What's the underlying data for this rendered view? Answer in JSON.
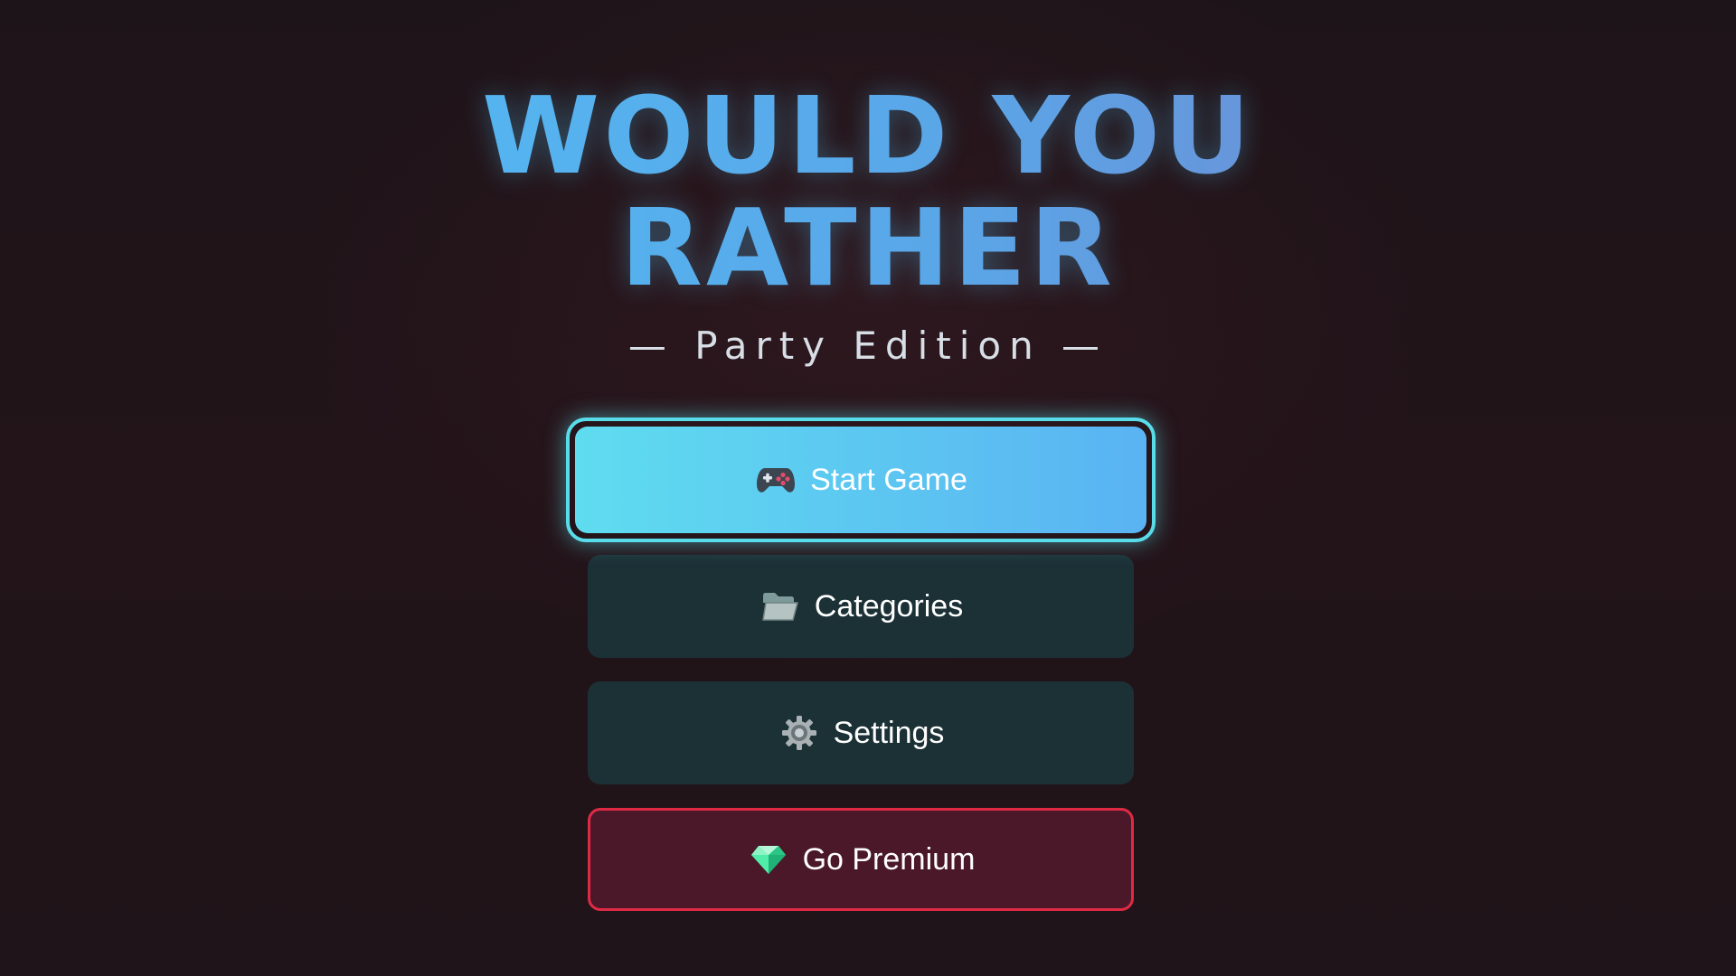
{
  "title": {
    "line1": "WOULD YOU",
    "line2": "RATHER"
  },
  "subtitle": "— Party Edition —",
  "menu": {
    "start": {
      "label": "Start Game",
      "icon": "game-controller-icon"
    },
    "categories": {
      "label": "Categories",
      "icon": "folder-icon"
    },
    "settings": {
      "label": "Settings",
      "icon": "gear-icon"
    },
    "premium": {
      "label": "Go Premium",
      "icon": "gem-icon"
    }
  },
  "colors": {
    "accent": "#59dcea",
    "primary_fill": "#5fdcf0",
    "secondary_fill": "#1c3136",
    "premium_border": "#e02a45",
    "premium_fill": "#4a1828"
  }
}
